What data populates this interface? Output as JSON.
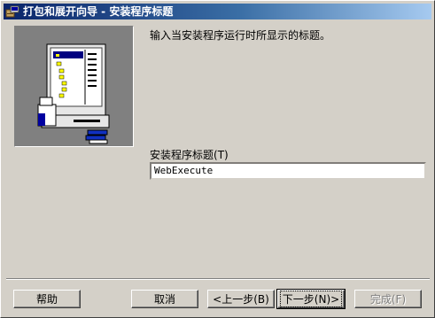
{
  "window": {
    "title": "打包和展开向导 - 安装程序标题",
    "icon": "package-wizard-icon"
  },
  "content": {
    "instruction": "输入当安装程序运行时所显示的标题。",
    "field_label": "安装程序标题",
    "field_label_accel": "(T)",
    "field_value": "WebExecute"
  },
  "buttons": {
    "help": "帮助",
    "cancel": "取消",
    "back": "<上一步(B)",
    "next": "下一步(N)>",
    "finish": "完成(F)"
  },
  "colors": {
    "face": "#d4d0c8",
    "title_start": "#0a246a",
    "title_end": "#a6caf0",
    "disabled_text": "#808080"
  }
}
